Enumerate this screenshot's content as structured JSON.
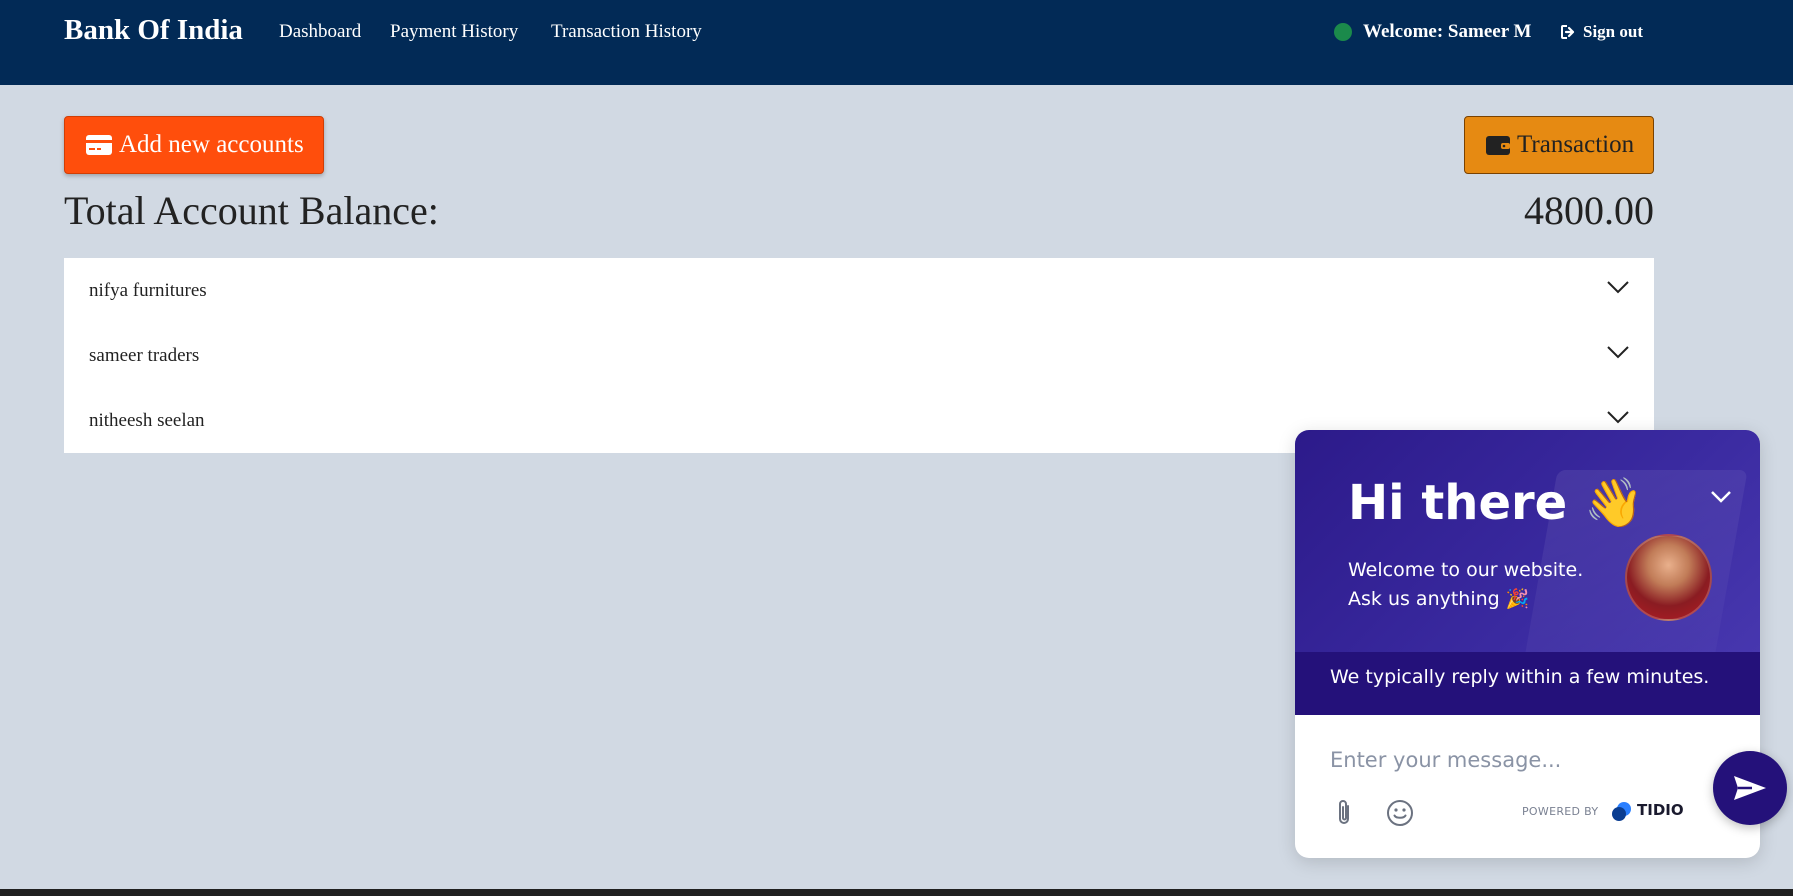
{
  "header": {
    "brand": "Bank Of India",
    "nav": [
      {
        "label": "Dashboard"
      },
      {
        "label": "Payment History"
      },
      {
        "label": "Transaction History"
      }
    ],
    "welcome": "Welcome: Sameer M",
    "signout": "Sign out",
    "status_color": "#1b8a4b"
  },
  "actions": {
    "add_accounts_label": "Add new accounts",
    "transaction_label": "Transaction"
  },
  "balance": {
    "label": "Total Account Balance:",
    "value": "4800.00"
  },
  "accounts": [
    {
      "name": "nifya furnitures"
    },
    {
      "name": "sameer traders"
    },
    {
      "name": "nitheesh seelan"
    }
  ],
  "chat": {
    "greeting": "Hi there 👋",
    "welcome_line1": "Welcome to our website.",
    "welcome_line2": "Ask us anything 🎉",
    "reply_note": "We typically reply within a few minutes.",
    "input_placeholder": "Enter your message...",
    "powered_by": "POWERED BY",
    "brand": "TIDIO"
  },
  "colors": {
    "navbar": "#022a56",
    "page_bg": "#d1d9e3",
    "add_button": "#ff4e0c",
    "transaction_button": "#e68a12",
    "chat_accent": "#24117a"
  }
}
